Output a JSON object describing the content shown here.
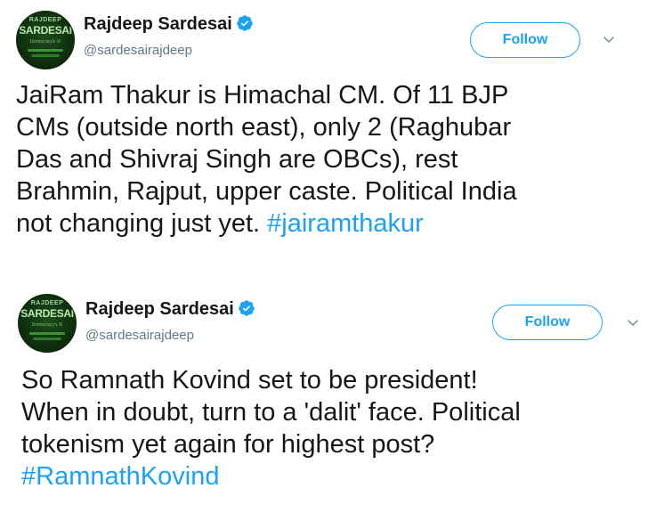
{
  "colors": {
    "accent": "#1da1f2",
    "text": "#14171a",
    "muted": "#657786"
  },
  "tweets": [
    {
      "avatar": {
        "top": "RAJDEEP",
        "main": "SARDESAI",
        "sub": "Democracy's XI"
      },
      "author_name": "Rajdeep Sardesai",
      "handle": "@sardesairajdeep",
      "verified_icon": "verified-badge-icon",
      "follow_label": "Follow",
      "more_icon": "chevron-down-icon",
      "lines": [
        "JaiRam Thakur is Himachal CM. Of 11 BJP",
        "CMs (outside north east), only 2 (Raghubar",
        "Das and Shivraj Singh are OBCs), rest",
        "Brahmin, Rajput, upper caste. Political India"
      ],
      "last_line_text": "not changing just yet. ",
      "hashtag": "#jairamthakur"
    },
    {
      "avatar": {
        "top": "RAJDEEP",
        "main": "SARDESAI",
        "sub": "Democracy's XI"
      },
      "author_name": "Rajdeep Sardesai",
      "handle": "@sardesairajdeep",
      "verified_icon": "verified-badge-icon",
      "follow_label": "Follow",
      "more_icon": "chevron-down-icon",
      "lines": [
        "So Ramnath Kovind set to be president!",
        "When in doubt, turn to a 'dalit' face. Political",
        "tokenism yet again for highest post?"
      ],
      "hashtag": "#RamnathKovind"
    }
  ]
}
